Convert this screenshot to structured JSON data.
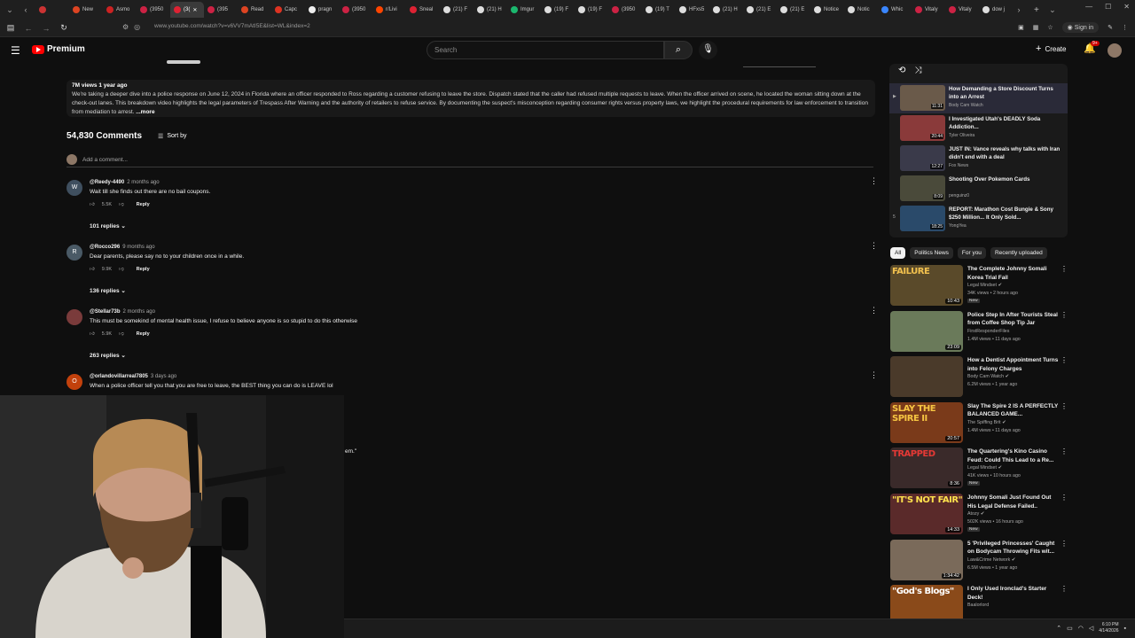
{
  "browser": {
    "tabs": [
      {
        "label": "",
        "color": "#cc3333"
      },
      {
        "label": "New",
        "color": "#dd4422"
      },
      {
        "label": "Asmo",
        "color": "#cc2222"
      },
      {
        "label": "(3950",
        "color": "#cc2244"
      },
      {
        "label": "(3(",
        "color": "#dd2233",
        "active": true
      },
      {
        "label": "(395",
        "color": "#cc2244"
      },
      {
        "label": "Read",
        "color": "#dd4422"
      },
      {
        "label": "Capc",
        "color": "#dd3322"
      },
      {
        "label": "pragn",
        "color": "#eeeeee"
      },
      {
        "label": "(3950",
        "color": "#cc2244"
      },
      {
        "label": "r/Livi",
        "color": "#ff4500"
      },
      {
        "label": "Sneal",
        "color": "#dd2233"
      },
      {
        "label": "(21) F",
        "color": "#dddddd"
      },
      {
        "label": "(21) H",
        "color": "#dddddd"
      },
      {
        "label": "Imgur",
        "color": "#1bb76e"
      },
      {
        "label": "(19) F",
        "color": "#dddddd"
      },
      {
        "label": "(19) F",
        "color": "#dddddd"
      },
      {
        "label": "(3950",
        "color": "#cc2244"
      },
      {
        "label": "(19) T",
        "color": "#dddddd"
      },
      {
        "label": "HFxs5",
        "color": "#dddddd"
      },
      {
        "label": "(21) H",
        "color": "#dddddd"
      },
      {
        "label": "(21) E",
        "color": "#dddddd"
      },
      {
        "label": "(21) E",
        "color": "#dddddd"
      },
      {
        "label": "Notice",
        "color": "#dddddd"
      },
      {
        "label": "Notic",
        "color": "#dddddd"
      },
      {
        "label": "Whic",
        "color": "#3a86ff"
      },
      {
        "label": "Vitaly",
        "color": "#cc2244"
      },
      {
        "label": "Vitaly",
        "color": "#cc2244"
      },
      {
        "label": "dow j",
        "color": "#dddddd"
      }
    ],
    "url": "www.youtube.com/watch?v=v6VV7mAtI5E&list=WL&index=2",
    "signin_label": "Sign in"
  },
  "masthead": {
    "logo_label": "Premium",
    "search_placeholder": "Search",
    "create_label": "Create",
    "notification_badge": "9+"
  },
  "description": {
    "meta": "7M views  1 year ago",
    "text": "We're taking a deeper dive into a police response on June 12, 2024 in Florida where an officer responded to Ross regarding a customer refusing to leave the store. Dispatch stated that the caller had refused multiple requests to leave. When the officer arrived on scene, he located the woman sitting down at the check-out lanes. This breakdown video highlights the legal parameters of Trespass After Warning and the authority of retailers to refuse service. By documenting the suspect's misconception regarding consumer rights versus property laws, we highlight the procedural requirements for law enforcement to transition from mediation to arrest.",
    "more_label": "...more"
  },
  "comments": {
    "count_label": "54,830 Comments",
    "sort_label": "Sort by",
    "add_placeholder": "Add a comment...",
    "items": [
      {
        "avatar_letter": "W",
        "avatar_color": "#3f4f5f",
        "author": "@Reedy-4490",
        "time": "2 months ago",
        "text": "Wait till she finds out there are no bail coupons.",
        "likes": "5.5K",
        "reply_label": "Reply",
        "replies": "101 replies"
      },
      {
        "avatar_letter": "R",
        "avatar_color": "#4a5a66",
        "author": "@Rocco296",
        "time": "9 months ago",
        "text": "Dear parents, please say no to your children once in a while.",
        "likes": "9.9K",
        "reply_label": "Reply",
        "replies": "136 replies"
      },
      {
        "avatar_letter": "",
        "avatar_color": "#7a3b3b",
        "author": "@Stellar73b",
        "time": "2 months ago",
        "text": "This must be somekind of mental health issue, I refuse to believe anyone is so stupid to do this otherwise",
        "likes": "5.9K",
        "reply_label": "Reply",
        "replies": "263 replies"
      },
      {
        "avatar_letter": "O",
        "avatar_color": "#c2410c",
        "author": "@orlandovillarreal7805",
        "time": "3 days ago",
        "text": "When a police officer tell you that you are free to leave, the BEST thing you can do is LEAVE lol"
      }
    ],
    "partial_text": "em.\""
  },
  "playlist": {
    "items": [
      {
        "index": "▶",
        "title": "How Demanding a Store Discount Turns into an Arrest",
        "channel": "Body Cam Watch",
        "duration": "11:31",
        "thumb_color": "#6a5a4a",
        "current": true
      },
      {
        "index": "",
        "title": "I Investigated Utah's DEADLY Soda Addiction...",
        "channel": "Tyler Oliveira",
        "duration": "20:44",
        "thumb_color": "#8a3a3a"
      },
      {
        "index": "",
        "title": "JUST IN: Vance reveals why talks with Iran didn't end with a deal",
        "channel": "Fox News",
        "duration": "12:27",
        "thumb_color": "#3a3a4a"
      },
      {
        "index": "",
        "title": "Shooting Over Pokemon Cards",
        "channel": "penguinz0",
        "duration": "8:09",
        "thumb_color": "#4a4a3a"
      },
      {
        "index": "5",
        "title": "REPORT: Marathon Cost Bungie & Sony $250 Million... It Only Sold...",
        "channel": "YongYea",
        "duration": "18:25",
        "thumb_color": "#2a4a6a"
      }
    ]
  },
  "chips": [
    "All",
    "Politics News",
    "For you",
    "Recently uploaded"
  ],
  "recommendations": [
    {
      "title": "The Complete Johnny Somali Korea Trial Fail",
      "channel": "Legal Mindset",
      "verified": true,
      "meta": "34K views • 2 hours ago",
      "new": "New",
      "duration": "10:43",
      "thumb_color": "#5a4a2a",
      "thumb_text": "FAILURE",
      "thumb_text_color": "#f2c14e"
    },
    {
      "title": "Police Step In After Tourists Steal from Coffee Shop Tip Jar",
      "channel": "FirstResponderFiles",
      "verified": false,
      "meta": "1.4M views • 11 days ago",
      "new": "",
      "duration": "23:09",
      "thumb_color": "#6a7a5a",
      "thumb_text": "",
      "thumb_text_color": "#ffffff"
    },
    {
      "title": "How a Dentist Appointment Turns into Felony Charges",
      "channel": "Body Cam Watch",
      "verified": true,
      "meta": "6.2M views • 1 year ago",
      "new": "",
      "duration": "",
      "thumb_color": "#4a3a2a",
      "thumb_text": "",
      "thumb_text_color": "#ffffff"
    },
    {
      "title": "Slay The Spire 2 IS A PERFECTLY BALANCED GAME...",
      "channel": "The Spiffing Brit",
      "verified": true,
      "meta": "1.4M views • 11 days ago",
      "new": "",
      "duration": "20:57",
      "thumb_color": "#7a3a1a",
      "thumb_text": "SLAY THE SPIRE II",
      "thumb_text_color": "#f6c542"
    },
    {
      "title": "The Quartering's Kino Casino Feud: Could This Lead to a Re...",
      "channel": "Legal Mindset",
      "verified": true,
      "meta": "41K views • 10 hours ago",
      "new": "New",
      "duration": "8:36",
      "thumb_color": "#3a2a2a",
      "thumb_text": "TRAPPED",
      "thumb_text_color": "#e53935"
    },
    {
      "title": "Johnny Somali Just Found Out His Legal Defense Failed..",
      "channel": "Atozy",
      "verified": true,
      "meta": "502K views • 16 hours ago",
      "new": "New",
      "duration": "14:33",
      "thumb_color": "#5a2a2a",
      "thumb_text": "\"IT'S NOT FAIR\"",
      "thumb_text_color": "#ffe14d"
    },
    {
      "title": "5 'Privileged Princesses' Caught on Bodycam Throwing Fits wit...",
      "channel": "Law&Crime Network",
      "verified": true,
      "meta": "6.5M views • 1 year ago",
      "new": "",
      "duration": "1:34:42",
      "thumb_color": "#7a6a5a",
      "thumb_text": "",
      "thumb_text_color": "#ffffff"
    },
    {
      "title": "I Only Used Ironclad's Starter Deck!",
      "channel": "Baalorlord",
      "verified": false,
      "meta": "",
      "new": "",
      "duration": "",
      "thumb_color": "#8a4a1a",
      "thumb_text": "\"God's Blogs\"",
      "thumb_text_color": "#ffffff"
    }
  ],
  "taskbar": {
    "time": "6:10 PM",
    "date": "4/14/2026"
  }
}
